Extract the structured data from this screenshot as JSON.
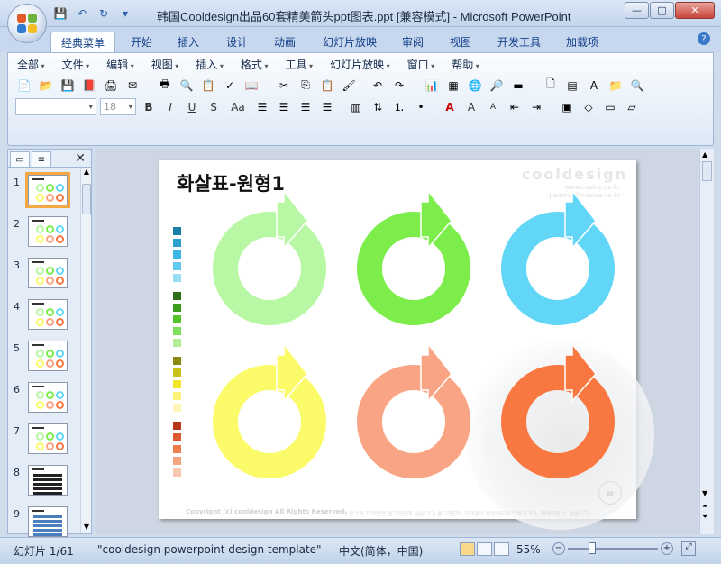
{
  "window": {
    "title": "韩国Cooldesign出品60套精美箭头ppt图表.ppt [兼容模式] - Microsoft PowerPoint",
    "minimize": "—",
    "maximize": "□",
    "close": "✕"
  },
  "ribbon_tabs": [
    "经典菜单",
    "开始",
    "插入",
    "设计",
    "动画",
    "幻灯片放映",
    "审阅",
    "视图",
    "开发工具",
    "加载项"
  ],
  "classic_menu": [
    "全部",
    "文件",
    "编辑",
    "视图",
    "插入",
    "格式",
    "工具",
    "幻灯片放映",
    "窗口",
    "帮助"
  ],
  "toolbar": {
    "font_size": "18",
    "bold": "B",
    "italic": "I",
    "underline": "U",
    "shadow": "S",
    "change_case": "Aa",
    "font_color": "A",
    "grow_font": "A",
    "shrink_font": "A"
  },
  "slide": {
    "title": "화살표-원형1",
    "brand": "cooldesign",
    "brand_url": "www.coolde.co.kr",
    "brand_email": "jteaman@coolde.co.kr",
    "copyright": "Copyright (c) cooldesign All Rights Reserved.",
    "copyright_kr": "이 문서의 저작권은 쿨디자인에 있습니다. 쿨디자인의 허가없이 상업적으로 이용하거나, 재배포할 수 없습니다.",
    "swatches": [
      [
        "#1a7fa8",
        "#2a9fd0",
        "#3db7e6",
        "#62c9f2",
        "#9bdcf7"
      ],
      [
        "#2d6e16",
        "#3c9a1e",
        "#52c42a",
        "#7fe05c",
        "#b6ef9b"
      ],
      [
        "#8c8a0e",
        "#c8c21a",
        "#f0e62a",
        "#fbf27a",
        "#fdf8b8"
      ],
      [
        "#b8361a",
        "#dd5a2e",
        "#ef7c4f",
        "#f5a37f",
        "#f9c8b0"
      ]
    ],
    "circles": [
      {
        "name": "light-green",
        "color": "#b8f7a3"
      },
      {
        "name": "green",
        "color": "#7ced4a"
      },
      {
        "name": "cyan",
        "color": "#62d6f7"
      },
      {
        "name": "yellow",
        "color": "#fbfb6a"
      },
      {
        "name": "salmon",
        "color": "#f9a585"
      },
      {
        "name": "orange",
        "color": "#f97841"
      }
    ]
  },
  "thumbnails": [
    "1",
    "2",
    "3",
    "4",
    "5",
    "6",
    "7",
    "8",
    "9"
  ],
  "status": {
    "slide_info": "幻灯片 1/61",
    "theme": "\"cooldesign powerpoint design template\"",
    "language": "中文(简体，中国)",
    "zoom": "55%"
  }
}
